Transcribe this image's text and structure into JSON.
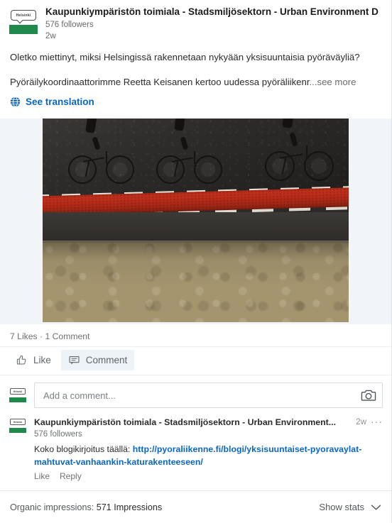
{
  "post": {
    "org_name": "Kaupunkiympäristön toimiala - Stadsmiljösektorn - Urban Environment D",
    "followers": "576 followers",
    "age": "2w",
    "logo_text": "Helsinki",
    "paragraph_1": "Oletko miettinyt, miksi Helsingissä rakennetaan nykyään yksisuuntaisia pyöräväyliä?",
    "paragraph_2": "Pyöräilykoordinaattorimme Reetta Keisanen kertoo uudessa pyöräliikenr",
    "see_more": "...see more",
    "see_translation": "See translation",
    "image_alt": "Three cyclists riding on a red one-way bike lane beside cobblestone pavement"
  },
  "social": {
    "counts": "7 Likes · 1 Comment",
    "like_label": "Like",
    "comment_label": "Comment"
  },
  "add_comment": {
    "placeholder": "Add a comment...",
    "camera_icon": "camera-icon"
  },
  "comment": {
    "author": "Kaupunkiympäristön toimiala - Stadsmiljösektorn - Urban Environment...",
    "followers": "576 followers",
    "age": "2w",
    "menu_icon": "ellipsis-icon",
    "text_prefix": "Koko blogikirjoitus täällä: ",
    "link": "http://pyoraliikenne.fi/blogi/yksisuuntaiset-pyoravaylat-mahtuvat-vanhaankin-katurakenteeseen/",
    "like_label": "Like",
    "reply_label": "Reply"
  },
  "footer": {
    "impressions_label": "Organic impressions: ",
    "impressions_value": "571 Impressions",
    "show_stats": "Show stats",
    "chevron_icon": "chevron-down-icon"
  },
  "colors": {
    "brand_blue": "#0a66c2",
    "helsinki_green": "#1f8a4c",
    "bike_lane_red": "#b52a18",
    "page_bg": "#ffffff",
    "photo_surround": "#f2f5f7"
  }
}
